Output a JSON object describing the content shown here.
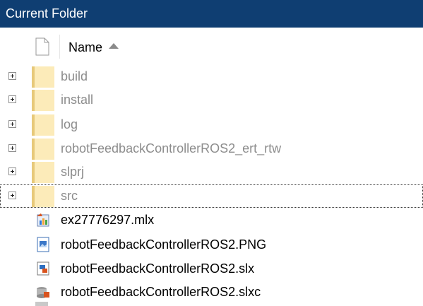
{
  "panel": {
    "title": "Current Folder"
  },
  "header": {
    "name_label": "Name",
    "file_icon": "blank-file-icon",
    "sort_icon": "sort-ascending-icon"
  },
  "folders": [
    {
      "label": "build"
    },
    {
      "label": "install"
    },
    {
      "label": "log"
    },
    {
      "label": "robotFeedbackControllerROS2_ert_rtw"
    },
    {
      "label": "slprj"
    },
    {
      "label": "src"
    }
  ],
  "files": [
    {
      "label": "ex27776297.mlx",
      "icon": "live-script-icon"
    },
    {
      "label": "robotFeedbackControllerROS2.PNG",
      "icon": "image-file-icon"
    },
    {
      "label": "robotFeedbackControllerROS2.slx",
      "icon": "simulink-model-icon"
    },
    {
      "label": "robotFeedbackControllerROS2.slxc",
      "icon": "simulink-cache-icon"
    }
  ],
  "colors": {
    "titlebar": "#0f3e72",
    "folder": "#fcebb9",
    "folder_text": "#8c8c8c"
  }
}
